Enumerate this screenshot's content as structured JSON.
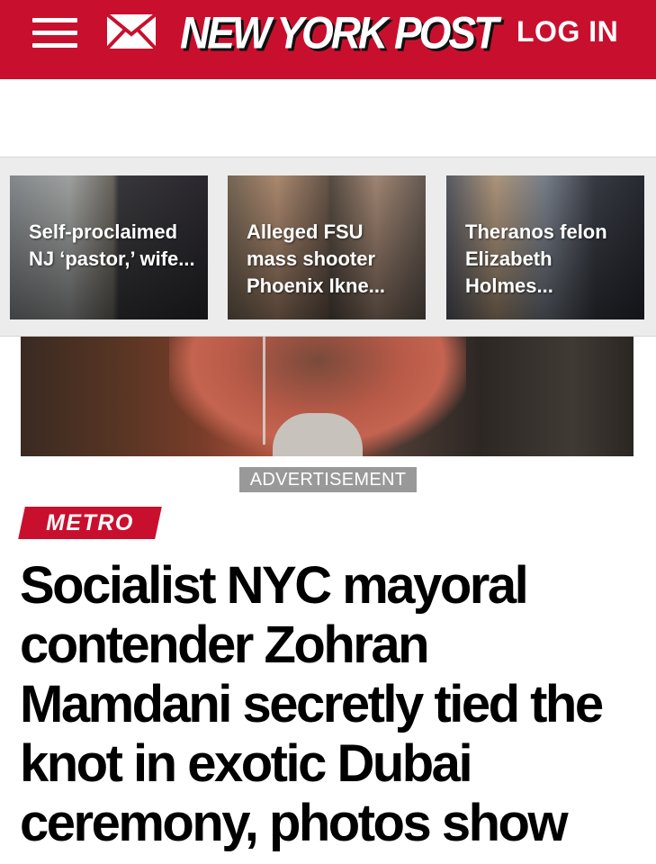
{
  "header": {
    "logo": "NEW YORK POST",
    "login_label": "LOG IN",
    "menu_icon": "hamburger-menu-icon",
    "mail_icon": "envelope-icon",
    "brand_color": "#c8102e"
  },
  "related_stories": [
    {
      "title": "Self-proclaimed NJ ‘pastor,’ wife..."
    },
    {
      "title": "Alleged FSU mass shooter Phoenix Ikne..."
    },
    {
      "title": "Theranos felon Elizabeth Holmes..."
    }
  ],
  "ad": {
    "label": "ADVERTISEMENT"
  },
  "article": {
    "section": "METRO",
    "headline": "Socialist NYC mayoral contender Zohran Mamdani secretly tied the knot in exotic Dubai ceremony, photos show"
  }
}
